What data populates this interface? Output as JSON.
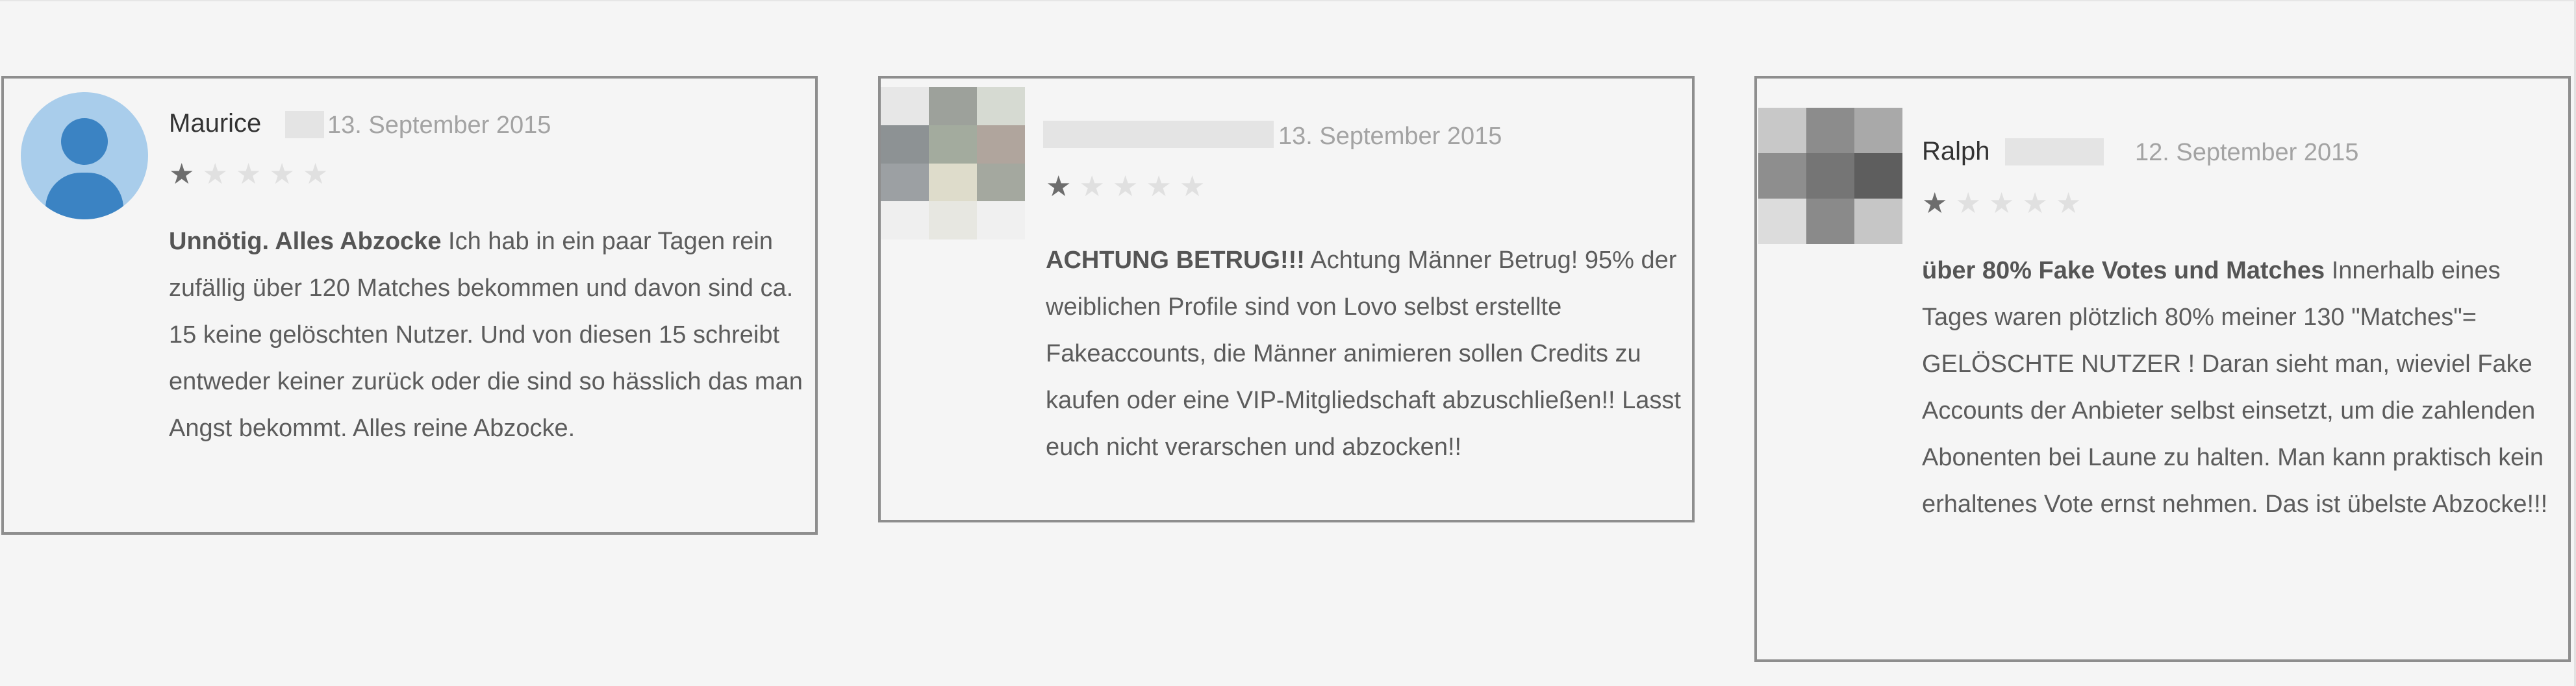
{
  "reviews": [
    {
      "author": "Maurice",
      "date": "13. September 2015",
      "rating": 1,
      "max_rating": 5,
      "title": "Unnötig. Alles Abzocke",
      "body": "Ich hab in ein paar Tagen rein zufällig über 120 Matches bekommen und davon sind ca. 15 keine gelöschten Nutzer. Und von diesen 15 schreibt entweder keiner zurück oder die sind so hässlich das man Angst bekommt. Alles reine Abzocke."
    },
    {
      "author": "",
      "date": "13. September 2015",
      "rating": 1,
      "max_rating": 5,
      "title": "ACHTUNG BETRUG!!!",
      "body": "Achtung Männer Betrug! 95% der weiblichen Profile sind von Lovo selbst erstellte Fakeaccounts, die Männer animieren sollen Credits zu kaufen oder eine VIP-Mitgliedschaft abzuschließen!! Lasst euch nicht verarschen und abzocken!!"
    },
    {
      "author": "Ralph",
      "date": "12. September 2015",
      "rating": 1,
      "max_rating": 5,
      "title": "über 80% Fake Votes und Matches",
      "body": "Innerhalb eines Tages waren plötzlich 80% meiner 130 \"Matches\"= GELÖSCHTE NUTZER ! Daran sieht man, wieviel Fake Accounts der Anbieter selbst einsetzt, um die zahlenden Abonenten bei Laune zu halten. Man kann praktisch kein erhaltenes Vote ernst nehmen. Das ist übelste Abzocke!!!"
    }
  ],
  "icons": {
    "star": "★",
    "avatar": "default-user-avatar",
    "pixelated_avatar": "pixelated-profile-photo"
  },
  "colors": {
    "background": "#f5f5f5",
    "card_border": "#8e8e8e",
    "star_filled": "#6d6d6d",
    "star_empty": "#e0e0e0",
    "date": "#a3a3a3",
    "text": "#5c5c5c",
    "avatar_bg": "#a9cdeb",
    "avatar_fg": "#3b83c3"
  }
}
